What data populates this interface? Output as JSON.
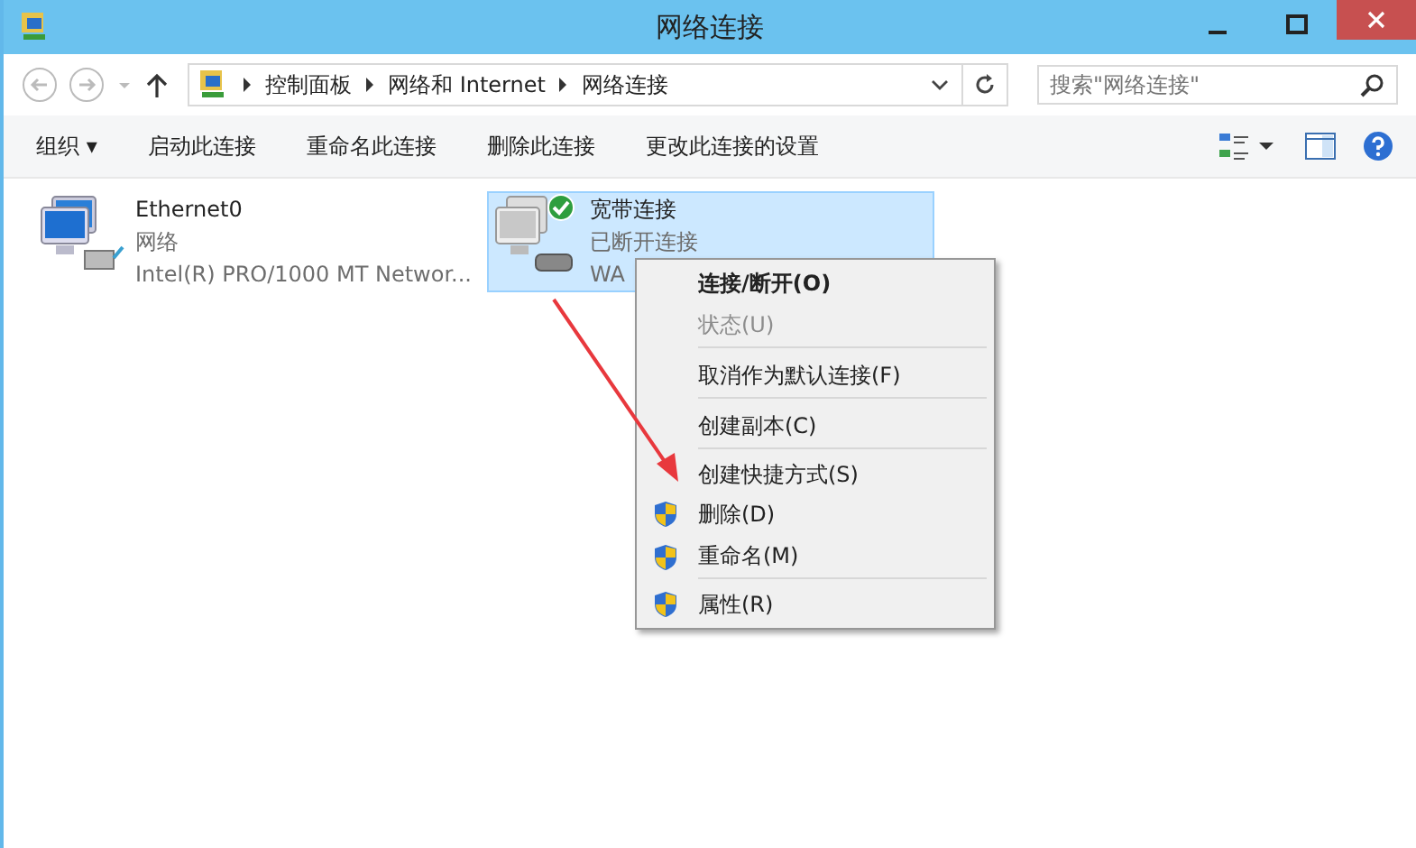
{
  "window": {
    "title": "网络连接"
  },
  "address": {
    "crumbs": [
      "控制面板",
      "网络和 Internet",
      "网络连接"
    ]
  },
  "search": {
    "placeholder": "搜索\"网络连接\""
  },
  "toolbar": {
    "organize": "组织 ▾",
    "commands": [
      "启动此连接",
      "重命名此连接",
      "删除此连接",
      "更改此连接的设置"
    ]
  },
  "connections": [
    {
      "name": "Ethernet0",
      "network": "网络",
      "device": "Intel(R) PRO/1000 MT Networ...",
      "selected": false,
      "kind": "ethernet"
    },
    {
      "name": "宽带连接",
      "network": "已断开连接",
      "device": "WA",
      "selected": true,
      "kind": "broadband"
    }
  ],
  "context_menu": {
    "items": [
      {
        "label": "连接/断开(O)",
        "bold": true,
        "disabled": false,
        "shield": false,
        "separator_after": false
      },
      {
        "label": "状态(U)",
        "bold": false,
        "disabled": true,
        "shield": false,
        "separator_after": true
      },
      {
        "label": "取消作为默认连接(F)",
        "bold": false,
        "disabled": false,
        "shield": false,
        "separator_after": true
      },
      {
        "label": "创建副本(C)",
        "bold": false,
        "disabled": false,
        "shield": false,
        "separator_after": true
      },
      {
        "label": "创建快捷方式(S)",
        "bold": false,
        "disabled": false,
        "shield": false,
        "separator_after": false
      },
      {
        "label": "删除(D)",
        "bold": false,
        "disabled": false,
        "shield": true,
        "separator_after": false
      },
      {
        "label": "重命名(M)",
        "bold": false,
        "disabled": false,
        "shield": true,
        "separator_after": true
      },
      {
        "label": "属性(R)",
        "bold": false,
        "disabled": false,
        "shield": true,
        "separator_after": false
      }
    ]
  }
}
